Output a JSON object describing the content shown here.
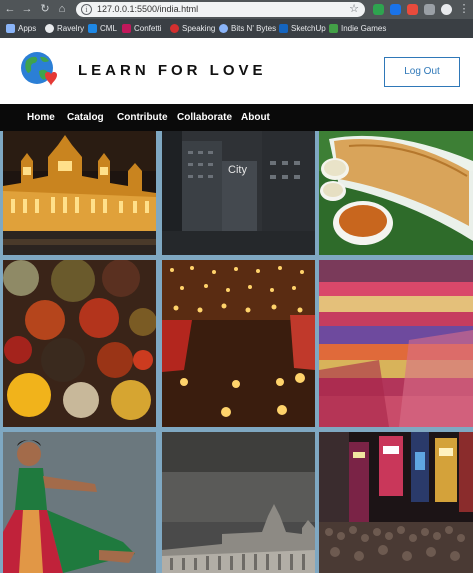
{
  "browser": {
    "url": "127.0.0.1:5500/india.html",
    "bookmarks": [
      "Apps",
      "Ravelry",
      "CML",
      "Confetti",
      "Speaking",
      "Bits N' Bytes",
      "SketchUp",
      "Indie Games"
    ]
  },
  "header": {
    "title": "LEARN FOR LOVE",
    "logout_label": "Log Out"
  },
  "nav": {
    "items": [
      "Home",
      "Catalog",
      "Contribute",
      "Collaborate",
      "About"
    ]
  },
  "gallery": {
    "city_label": "City",
    "tiles": [
      "palace-lights-tile",
      "city-tile",
      "dosa-tile",
      "spices-tile",
      "diyas-tile",
      "textiles-tile",
      "dancer-tile",
      "monument-tile",
      "street-tile"
    ]
  },
  "colors": {
    "accent": "#2f78b8",
    "nav_bg": "#0a0a0a",
    "gallery_bg": "#7fa8c2"
  }
}
